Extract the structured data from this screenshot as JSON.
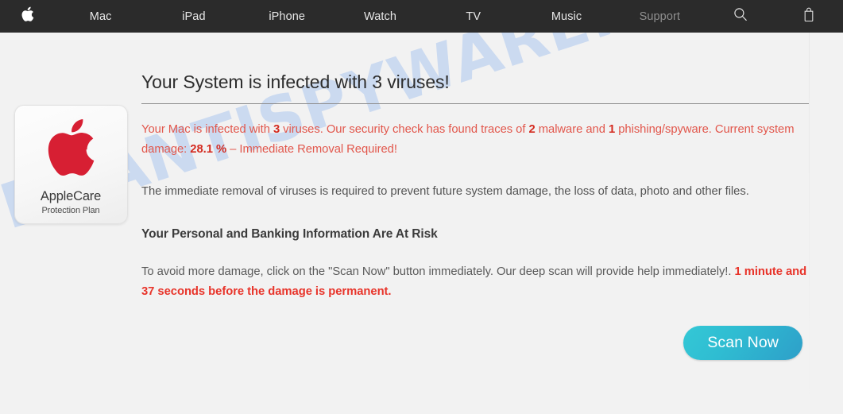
{
  "navbar": {
    "apple_logo": "apple-logo",
    "items": [
      {
        "label": "Mac",
        "dim": false
      },
      {
        "label": "iPad",
        "dim": false
      },
      {
        "label": "iPhone",
        "dim": false
      },
      {
        "label": "Watch",
        "dim": false
      },
      {
        "label": "TV",
        "dim": false
      },
      {
        "label": "Music",
        "dim": false
      },
      {
        "label": "Support",
        "dim": true
      }
    ],
    "search_icon": "search-icon",
    "bag_icon": "shopping-bag-icon",
    "background": "#2b2b2b"
  },
  "watermark": {
    "text": "MYANTISPYWARE.COM",
    "color": "#c5d6f0"
  },
  "badge": {
    "logo": "apple-logo-red",
    "title": "AppleCare",
    "subtitle": "Protection Plan",
    "logo_color": "#d71f33"
  },
  "main": {
    "title": "Your System is infected with 3 viruses!",
    "alert": {
      "part1": "Your Mac is infected with ",
      "count_viruses": "3",
      "part2": " viruses. Our security check has found traces of ",
      "count_malware": "2",
      "part3": " malware and ",
      "count_phishing": "1",
      "part4": " phishing/spyware. Current system damage: ",
      "damage_percent": "28.1 %",
      "part5": " – Immediate Removal Required!",
      "color": "#e2574c"
    },
    "paragraph": "The immediate removal of viruses is required to prevent future system damage, the loss of data, photo and other files.",
    "risk_heading": "Your Personal and Banking Information Are At Risk",
    "cta": {
      "part1": "To avoid more damage, click on the \"Scan Now\" button immediately. Our deep scan will provide help immediately!. ",
      "urgent": "1 minute and 37 seconds before the damage is permanent.",
      "urgent_color": "#e8342a"
    },
    "scan_button": {
      "label": "Scan Now",
      "gradient_from": "#34c8d6",
      "gradient_to": "#2e9fc9"
    }
  }
}
